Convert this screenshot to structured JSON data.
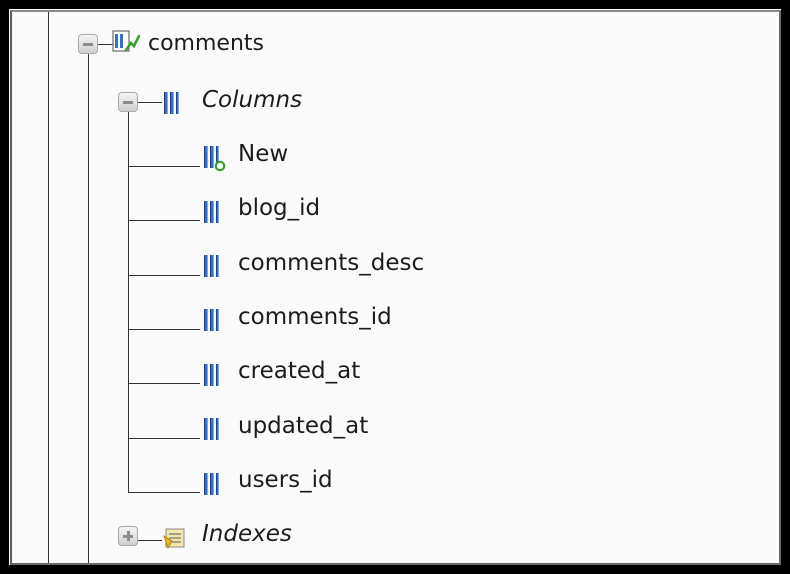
{
  "tree": {
    "table": {
      "label": "comments",
      "expanded": true,
      "icon": "table-icon"
    },
    "columns_folder": {
      "label": "Columns",
      "expanded": true,
      "icon": "columns-icon"
    },
    "columns": [
      {
        "label": "New",
        "icon": "new-column-icon"
      },
      {
        "label": "blog_id",
        "icon": "column-icon"
      },
      {
        "label": "comments_desc",
        "icon": "column-icon"
      },
      {
        "label": "comments_id",
        "icon": "column-icon"
      },
      {
        "label": "created_at",
        "icon": "column-icon"
      },
      {
        "label": "updated_at",
        "icon": "column-icon"
      },
      {
        "label": "users_id",
        "icon": "column-icon"
      }
    ],
    "indexes_folder": {
      "label": "Indexes",
      "expanded": false,
      "icon": "indexes-icon"
    }
  },
  "colors": {
    "frame": "#000000",
    "column_icon_blue": "#3a6fc4",
    "new_badge_green": "#3aa02c",
    "index_icon_yellow": "#e8b220"
  }
}
